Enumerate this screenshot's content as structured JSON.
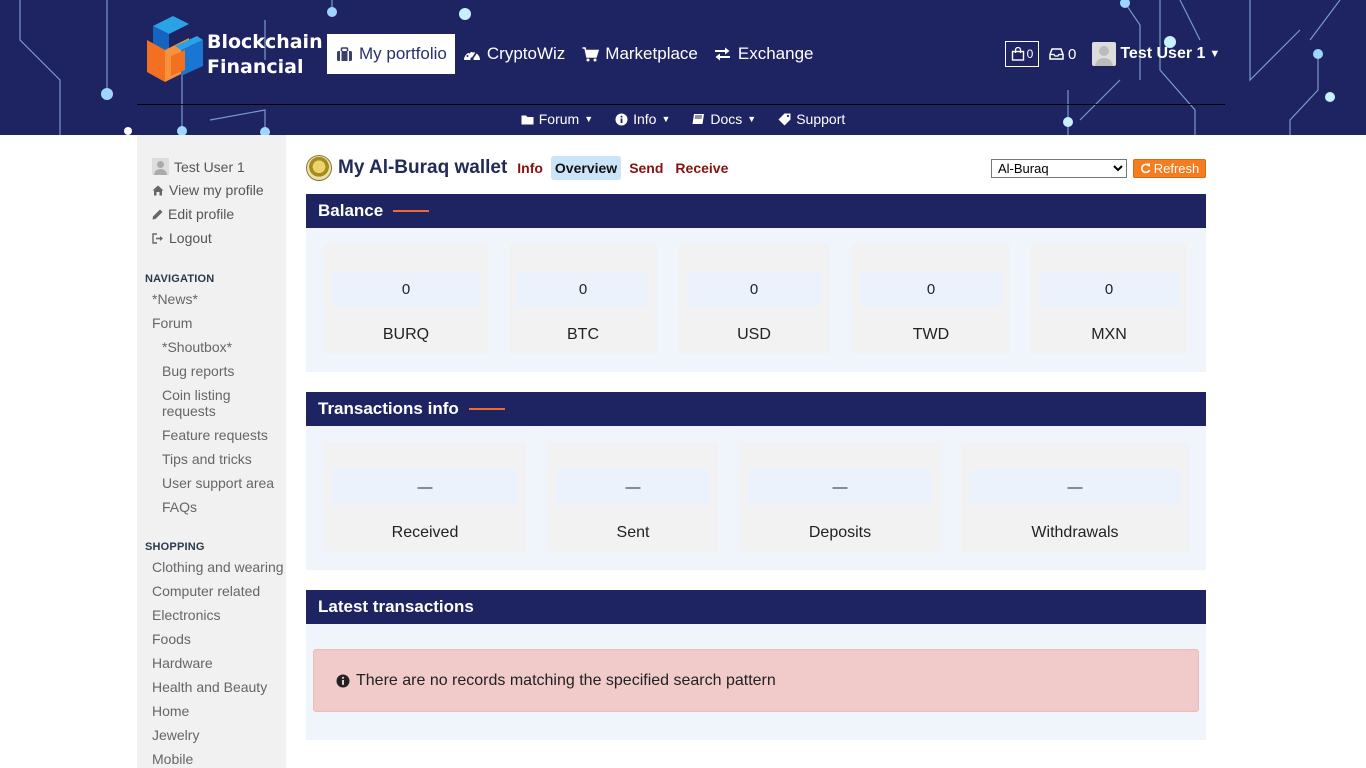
{
  "brand": {
    "line1": "Blockchain",
    "line2": "Financial"
  },
  "main_nav": [
    {
      "label": "My portfolio",
      "icon": "briefcase-icon",
      "active": true
    },
    {
      "label": "CryptoWiz",
      "icon": "dashboard-icon"
    },
    {
      "label": "Marketplace",
      "icon": "cart-icon"
    },
    {
      "label": "Exchange",
      "icon": "exchange-icon"
    }
  ],
  "header_right": {
    "cart_count": "0",
    "inbox_count": "0",
    "user_name": "Test User 1"
  },
  "sub_nav": [
    {
      "label": "Forum",
      "icon": "folder-icon",
      "dropdown": true
    },
    {
      "label": "Info",
      "icon": "info-icon",
      "dropdown": true
    },
    {
      "label": "Docs",
      "icon": "book-icon",
      "dropdown": true
    },
    {
      "label": "Support",
      "icon": "tag-icon",
      "dropdown": false
    }
  ],
  "sidebar": {
    "user_links": [
      {
        "label": "Test User 1",
        "icon": "avatar-icon"
      },
      {
        "label": "View my profile",
        "icon": "home-icon"
      },
      {
        "label": "Edit profile",
        "icon": "pencil-icon"
      },
      {
        "label": "Logout",
        "icon": "logout-icon"
      }
    ],
    "navigation_heading": "NAVIGATION",
    "navigation": [
      {
        "label": "*News*",
        "level": 0
      },
      {
        "label": "Forum",
        "level": 0
      },
      {
        "label": "*Shoutbox*",
        "level": 1
      },
      {
        "label": "Bug reports",
        "level": 1
      },
      {
        "label": "Coin listing requests",
        "level": 1
      },
      {
        "label": "Feature requests",
        "level": 1
      },
      {
        "label": "Tips and tricks",
        "level": 1
      },
      {
        "label": "User support area",
        "level": 1
      },
      {
        "label": "FAQs",
        "level": 1
      }
    ],
    "shopping_heading": "SHOPPING",
    "shopping": [
      "Clothing and wearing",
      "Computer related",
      "Electronics",
      "Foods",
      "Hardware",
      "Health and Beauty",
      "Home",
      "Jewelry",
      "Mobile"
    ]
  },
  "wallet": {
    "title": "My Al-Buraq wallet",
    "tabs": [
      {
        "label": "Info",
        "active": false
      },
      {
        "label": "Overview",
        "active": true
      },
      {
        "label": "Send",
        "active": false
      },
      {
        "label": "Receive",
        "active": false
      }
    ],
    "selected_wallet": "Al-Buraq",
    "refresh_label": "Refresh"
  },
  "balance": {
    "heading": "Balance",
    "items": [
      {
        "value": "0",
        "currency": "BURQ"
      },
      {
        "value": "0",
        "currency": "BTC"
      },
      {
        "value": "0",
        "currency": "USD"
      },
      {
        "value": "0",
        "currency": "TWD"
      },
      {
        "value": "0",
        "currency": "MXN"
      }
    ]
  },
  "transactions_info": {
    "heading": "Transactions info",
    "items": [
      {
        "value": "—",
        "label": "Received"
      },
      {
        "value": "—",
        "label": "Sent"
      },
      {
        "value": "—",
        "label": "Deposits"
      },
      {
        "value": "—",
        "label": "Withdrawals"
      }
    ]
  },
  "latest_transactions": {
    "heading": "Latest transactions",
    "empty_message": "There are no records matching the specified search pattern"
  },
  "colors": {
    "header_bg": "#1e2461",
    "accent": "#f26a2a",
    "refresh": "#f57c1f",
    "alert_bg": "#f1cbca"
  }
}
